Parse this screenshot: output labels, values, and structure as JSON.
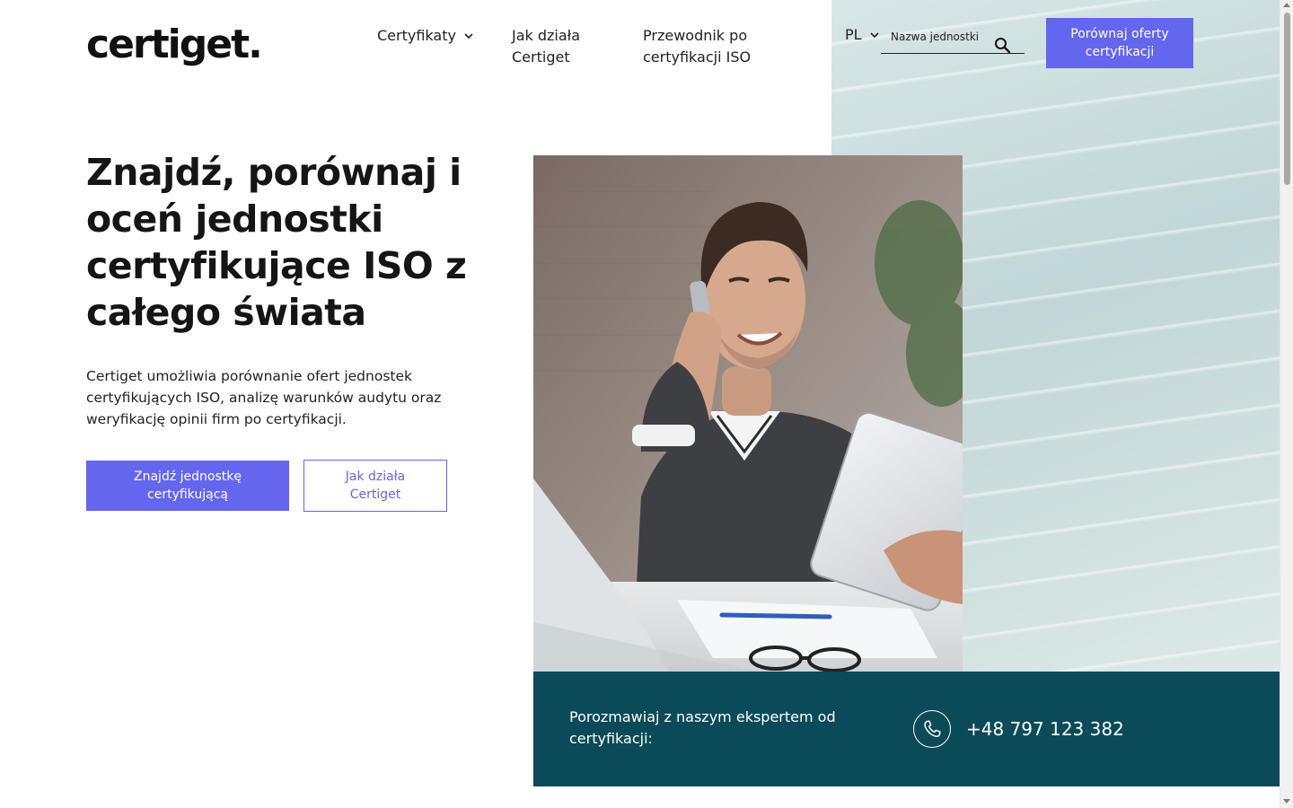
{
  "brand": {
    "logo": "certiget."
  },
  "nav": {
    "items": [
      {
        "label": "Certyfikaty",
        "has_dropdown": true
      },
      {
        "label": "Jak działa Certiget"
      },
      {
        "label": "Przewodnik po certyfikacji ISO"
      }
    ],
    "language": "PL",
    "search_placeholder": "Nazwa jednostki",
    "cta_label": "Porównaj oferty certyfikacji"
  },
  "hero": {
    "title": "Znajdź, porównaj i oceń jednostki certyfikujące ISO z całego świata",
    "description": "Certiget umożliwia porównanie ofert jednostek certyfikujących ISO, analizę warunków audytu oraz weryfikację opinii firm po certyfikacji.",
    "primary_button": "Znajdź jednostkę certyfikującą",
    "secondary_button": "Jak działa Certiget"
  },
  "contact": {
    "text": "Porozmawiaj z naszym ekspertem od certyfikacji:",
    "phone": "+48 797 123 382"
  },
  "colors": {
    "accent": "#6466ee",
    "contact_bar": "#0b4b59",
    "panel_bg": "#c9dcdc"
  },
  "icons": [
    "chevron-down-icon",
    "search-icon",
    "phone-icon"
  ]
}
